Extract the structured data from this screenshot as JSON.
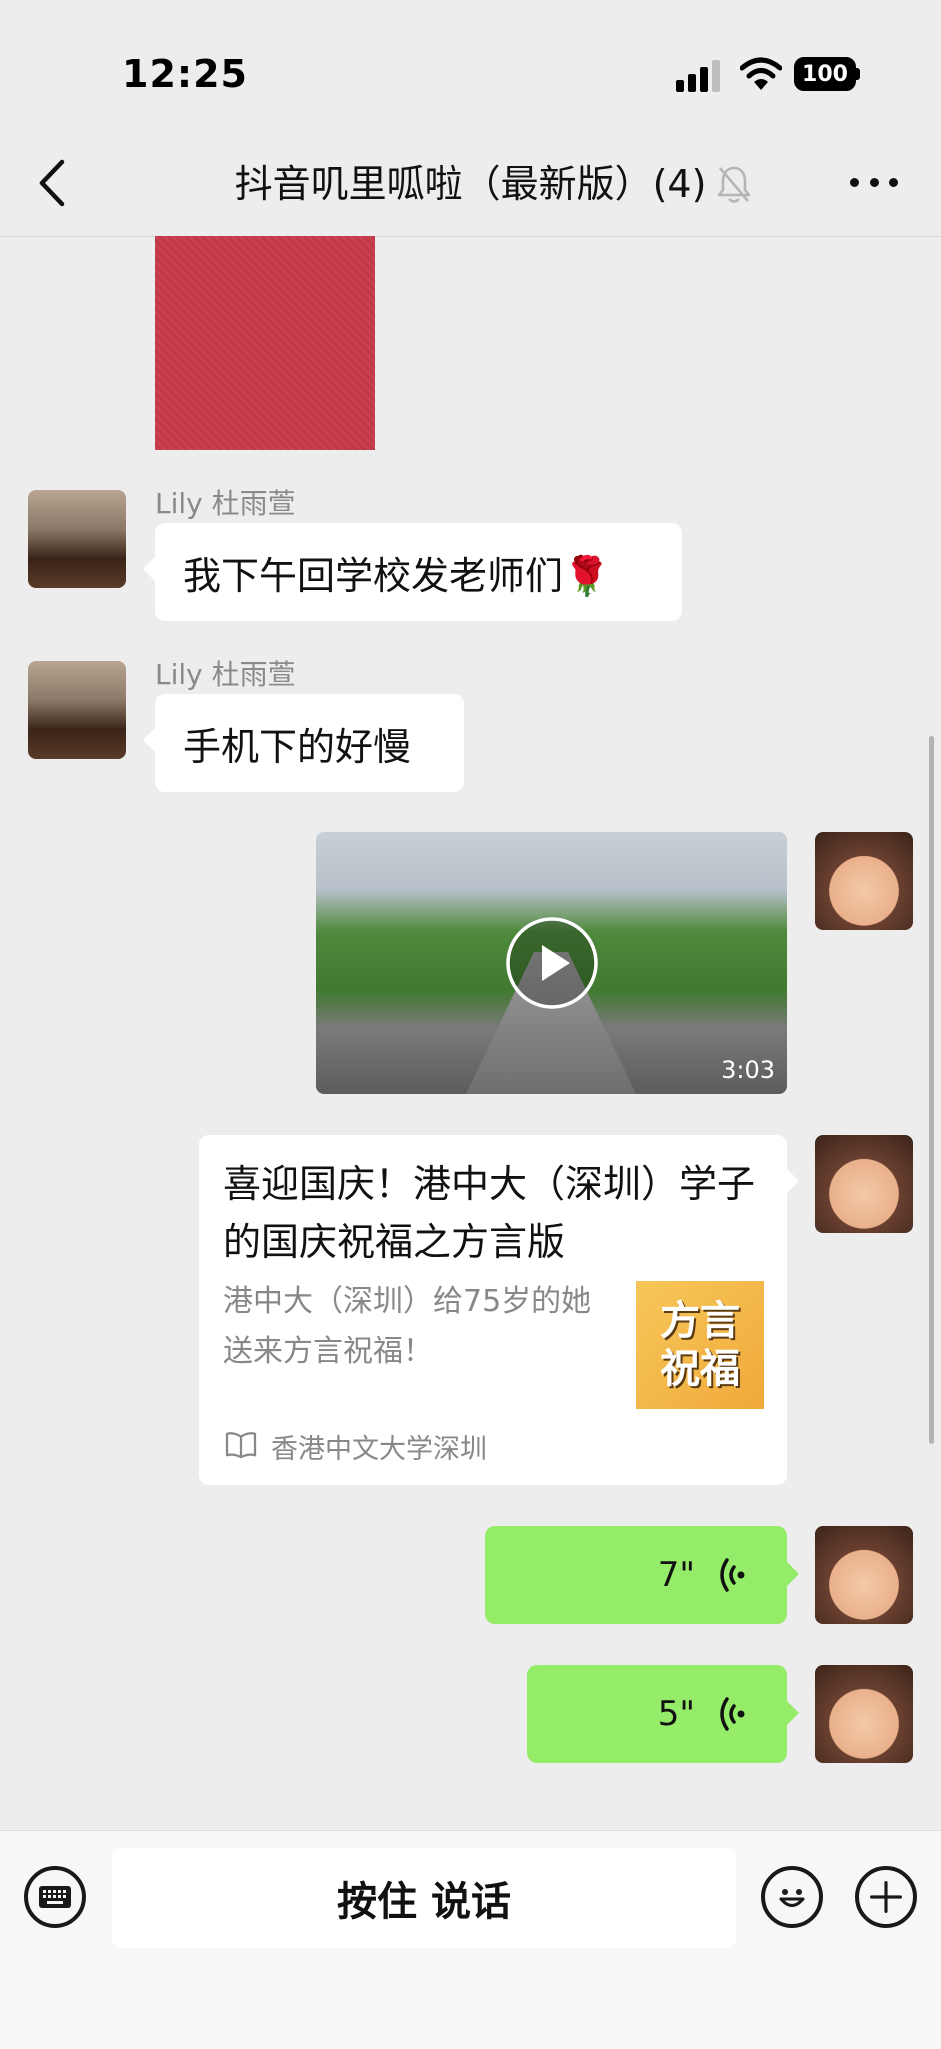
{
  "status_bar": {
    "time": "12:25",
    "battery": "100"
  },
  "header": {
    "title": "抖音叽里呱啦（最新版）(4)"
  },
  "messages": {
    "msg1": {
      "sender": "Lily 杜雨萱",
      "text": "我下午回学校发老师们🌹"
    },
    "msg2": {
      "sender": "Lily 杜雨萱",
      "text": "手机下的好慢"
    },
    "video": {
      "duration": "3:03"
    },
    "article": {
      "title": "喜迎国庆！港中大（深圳）学子的国庆祝福之方言版",
      "description": "港中大（深圳）给75岁的她送来方言祝福！",
      "thumb_text": "方言祝福",
      "source": "香港中文大学深圳"
    },
    "voice1": {
      "duration": "7\""
    },
    "voice2": {
      "duration": "5\""
    }
  },
  "input_bar": {
    "talk_label": "按住 说话"
  },
  "colors": {
    "background": "#ededed",
    "voice_bubble": "#95ec69",
    "text_bubble": "#ffffff"
  },
  "icons": [
    "back-icon",
    "mute-bell-icon",
    "more-icon",
    "play-icon",
    "voice-wave-icon",
    "book-icon",
    "keyboard-icon",
    "emoji-icon",
    "plus-icon"
  ]
}
